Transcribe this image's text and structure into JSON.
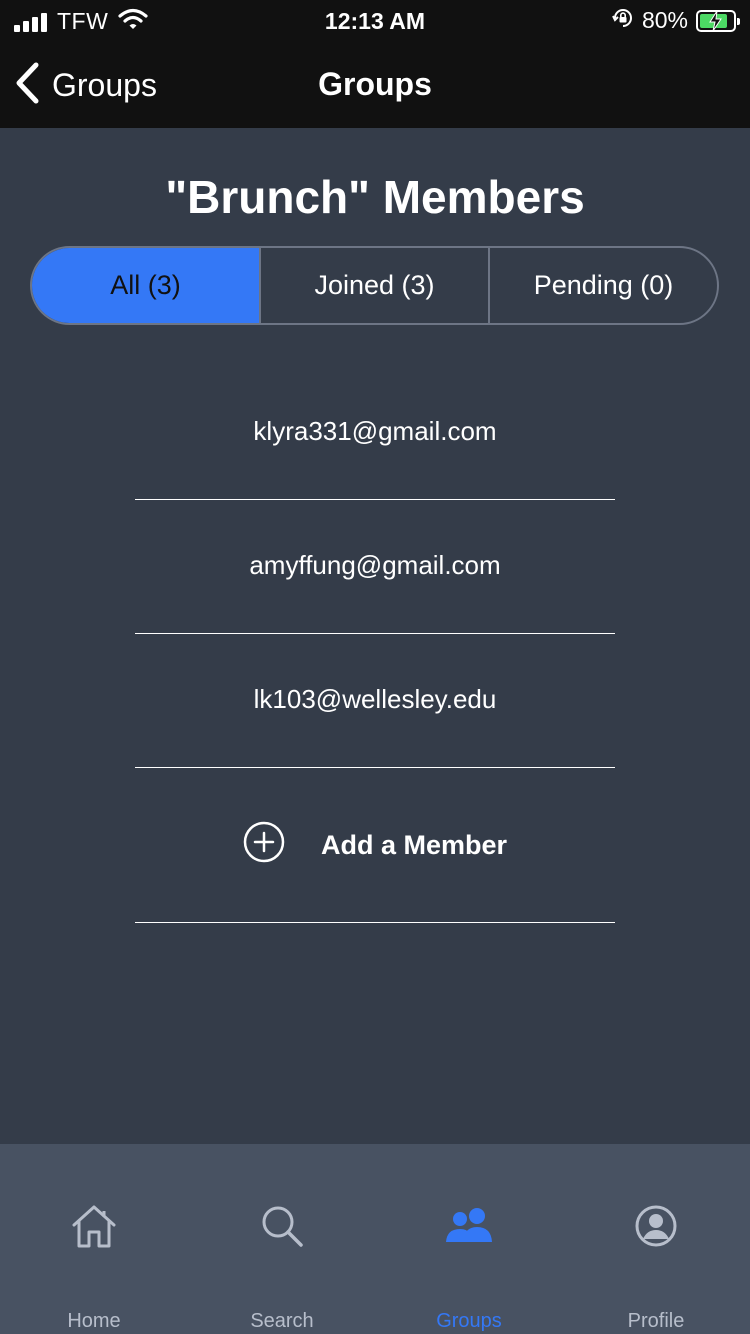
{
  "status_bar": {
    "carrier": "TFW",
    "time": "12:13 AM",
    "battery_percent": "80%",
    "battery_level": 0.8,
    "icons": [
      "signal-icon",
      "wifi-icon",
      "orientation-lock-icon",
      "battery-charging-icon"
    ]
  },
  "nav": {
    "back_label": "Groups",
    "title": "Groups",
    "back_icon": "chevron-left-icon"
  },
  "page": {
    "title": "\"Brunch\" Members"
  },
  "tabs": [
    {
      "label": "All (3)",
      "active": true
    },
    {
      "label": "Joined (3)",
      "active": false
    },
    {
      "label": "Pending (0)",
      "active": false
    }
  ],
  "members": [
    "klyra331@gmail.com",
    "amyffung@gmail.com",
    "lk103@wellesley.edu"
  ],
  "add_member": {
    "label": "Add a Member",
    "icon": "plus-circle-icon"
  },
  "tab_bar": {
    "items": [
      {
        "label": "Home",
        "icon": "home-icon",
        "active": false
      },
      {
        "label": "Search",
        "icon": "search-icon",
        "active": false
      },
      {
        "label": "Groups",
        "icon": "people-icon",
        "active": true
      },
      {
        "label": "Profile",
        "icon": "profile-icon",
        "active": false
      }
    ]
  },
  "colors": {
    "background": "#343c49",
    "bar": "#111111",
    "accent": "#3478f6",
    "tab_bar": "#485262"
  }
}
